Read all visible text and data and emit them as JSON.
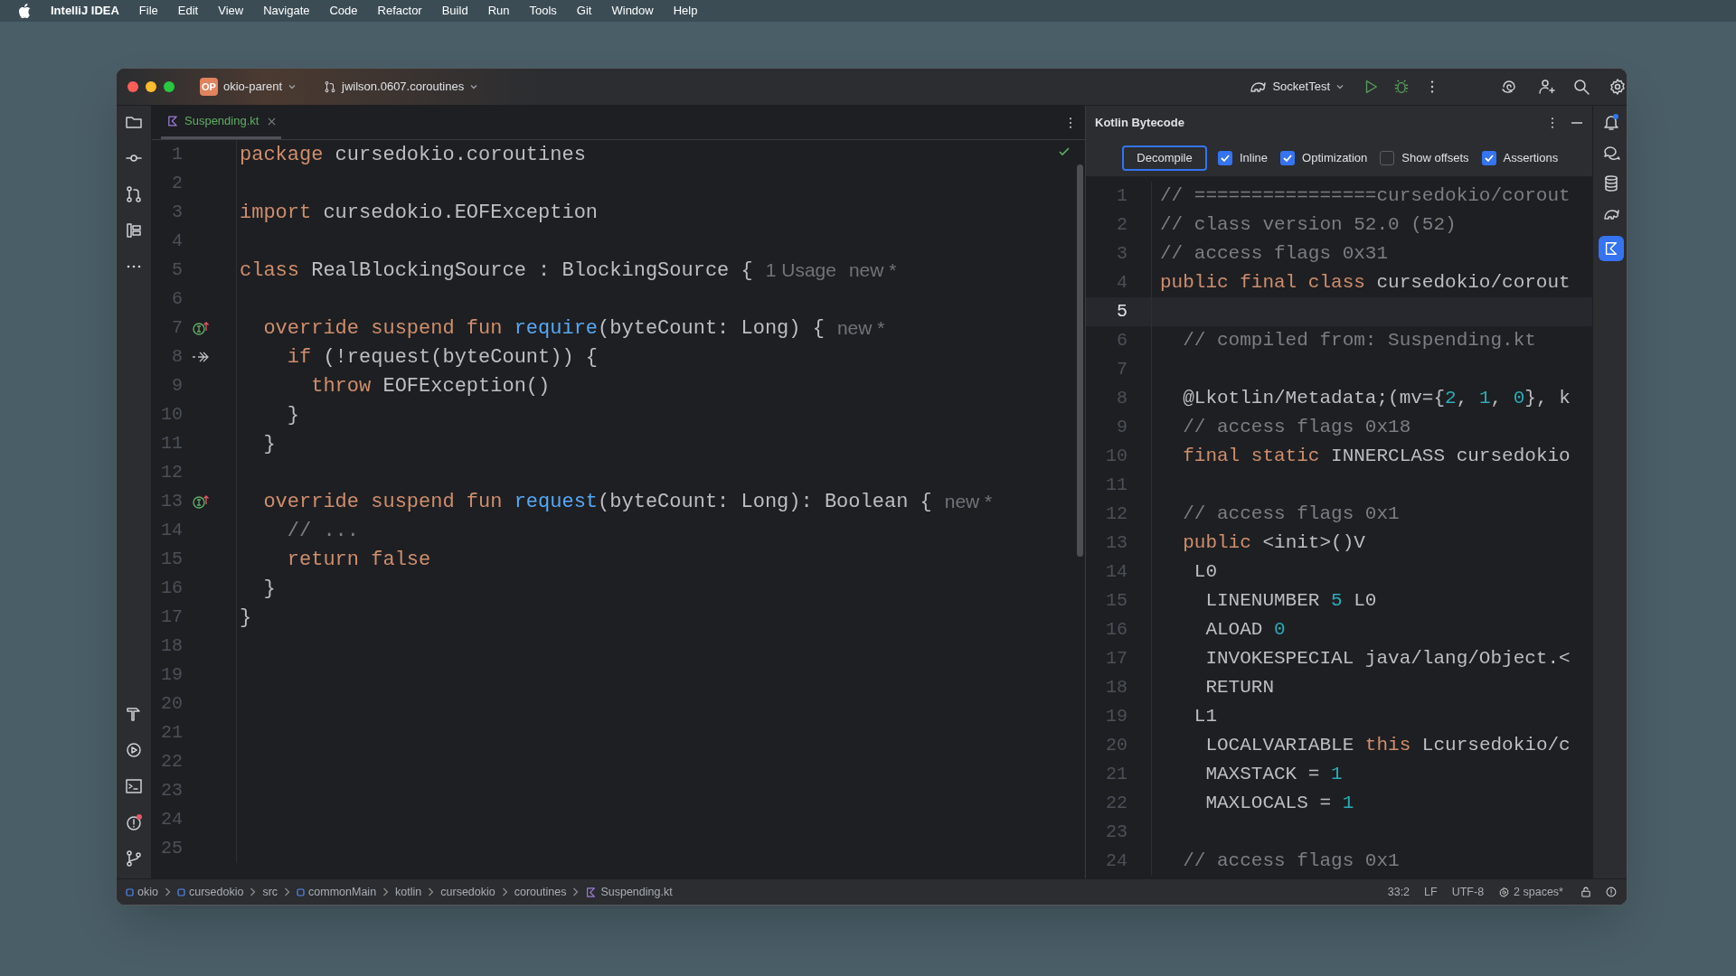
{
  "menu_bar": {
    "app_name": "IntelliJ IDEA",
    "menus": [
      "File",
      "Edit",
      "View",
      "Navigate",
      "Code",
      "Refactor",
      "Build",
      "Run",
      "Tools",
      "Git",
      "Window",
      "Help"
    ]
  },
  "title_bar": {
    "project_badge": "OP",
    "project": "okio-parent",
    "branch": "jwilson.0607.coroutines",
    "run_configuration": "SocketTest"
  },
  "editor": {
    "tabs": [
      {
        "label": "Suspending.kt",
        "selected": true
      }
    ],
    "lines": [
      {
        "number": "1",
        "tokens": [
          {
            "kind": "keyword",
            "text": "package"
          },
          {
            "kind": "plain",
            "text": " cursedokio.coroutines"
          }
        ]
      },
      {
        "number": "2"
      },
      {
        "number": "3",
        "tokens": [
          {
            "kind": "keyword",
            "text": "import"
          },
          {
            "kind": "plain",
            "text": " cursedokio.EOFException"
          }
        ]
      },
      {
        "number": "4"
      },
      {
        "number": "5",
        "tokens": [
          {
            "kind": "keyword",
            "text": "class"
          },
          {
            "kind": "plain",
            "text": " RealBlockingSource : BlockingSource {"
          }
        ],
        "hints": [
          "1 Usage",
          "new *"
        ]
      },
      {
        "number": "6"
      },
      {
        "number": "7",
        "gutter": {
          "kind": "overrides"
        },
        "tokens": [
          {
            "kind": "keyword",
            "text": "  override suspend fun "
          },
          {
            "kind": "function",
            "text": "require"
          },
          {
            "kind": "plain",
            "text": "(byteCount: Long) {"
          }
        ],
        "hints": [
          "new *"
        ]
      },
      {
        "number": "8",
        "gutter": {
          "kind": "suspend_call"
        },
        "tokens": [
          {
            "kind": "keyword",
            "text": "    if"
          },
          {
            "kind": "plain",
            "text": " (!request(byteCount)) {"
          }
        ]
      },
      {
        "number": "9",
        "tokens": [
          {
            "kind": "keyword",
            "text": "      throw"
          },
          {
            "kind": "plain",
            "text": " EOFException()"
          }
        ]
      },
      {
        "number": "10",
        "tokens": [
          {
            "kind": "plain",
            "text": "    }"
          }
        ]
      },
      {
        "number": "11",
        "tokens": [
          {
            "kind": "plain",
            "text": "  }"
          }
        ]
      },
      {
        "number": "12"
      },
      {
        "number": "13",
        "gutter": {
          "kind": "overrides"
        },
        "tokens": [
          {
            "kind": "keyword",
            "text": "  override suspend fun "
          },
          {
            "kind": "function",
            "text": "request"
          },
          {
            "kind": "plain",
            "text": "(byteCount: Long): Boolean {"
          }
        ],
        "hints": [
          "new *"
        ]
      },
      {
        "number": "14",
        "tokens": [
          {
            "kind": "comment",
            "text": "    // ..."
          }
        ]
      },
      {
        "number": "15",
        "tokens": [
          {
            "kind": "keyword",
            "text": "    return false"
          }
        ]
      },
      {
        "number": "16",
        "tokens": [
          {
            "kind": "plain",
            "text": "  }"
          }
        ]
      },
      {
        "number": "17",
        "tokens": [
          {
            "kind": "plain",
            "text": "}"
          }
        ]
      },
      {
        "number": "18"
      },
      {
        "number": "19"
      },
      {
        "number": "20"
      },
      {
        "number": "21"
      },
      {
        "number": "22"
      },
      {
        "number": "23"
      },
      {
        "number": "24"
      },
      {
        "number": "25"
      }
    ]
  },
  "bytecode_panel": {
    "title": "Kotlin Bytecode",
    "decompile_button": "Decompile",
    "options": [
      {
        "label": "Inline",
        "checked": true
      },
      {
        "label": "Optimization",
        "checked": true
      },
      {
        "label": "Show offsets",
        "checked": false
      },
      {
        "label": "Assertions",
        "checked": true
      }
    ],
    "lines": [
      {
        "number": "1",
        "current": false,
        "tokens": [
          {
            "kind": "comment",
            "text": "// ================cursedokio/corout"
          }
        ]
      },
      {
        "number": "2",
        "current": false,
        "tokens": [
          {
            "kind": "comment",
            "text": "// class version 52.0 (52)"
          }
        ]
      },
      {
        "number": "3",
        "current": false,
        "tokens": [
          {
            "kind": "comment",
            "text": "// access flags 0x31"
          }
        ]
      },
      {
        "number": "4",
        "current": false,
        "tokens": [
          {
            "kind": "keyword",
            "text": "public final class"
          },
          {
            "kind": "plain",
            "text": " cursedokio/corout"
          }
        ]
      },
      {
        "number": "5",
        "current": true
      },
      {
        "number": "6",
        "current": false,
        "tokens": [
          {
            "kind": "comment",
            "text": "  // compiled from: Suspending.kt"
          }
        ]
      },
      {
        "number": "7",
        "current": false
      },
      {
        "number": "8",
        "current": false,
        "tokens": [
          {
            "kind": "plain",
            "text": "  @Lkotlin/Metadata;(mv={"
          },
          {
            "kind": "number",
            "text": "2"
          },
          {
            "kind": "plain",
            "text": ", "
          },
          {
            "kind": "number",
            "text": "1"
          },
          {
            "kind": "plain",
            "text": ", "
          },
          {
            "kind": "number",
            "text": "0"
          },
          {
            "kind": "plain",
            "text": "}, k"
          }
        ]
      },
      {
        "number": "9",
        "current": false,
        "tokens": [
          {
            "kind": "comment",
            "text": "  // access flags 0x18"
          }
        ]
      },
      {
        "number": "10",
        "current": false,
        "tokens": [
          {
            "kind": "keyword",
            "text": "  final static"
          },
          {
            "kind": "plain",
            "text": " INNERCLASS cursedokio"
          }
        ]
      },
      {
        "number": "11",
        "current": false
      },
      {
        "number": "12",
        "current": false,
        "tokens": [
          {
            "kind": "comment",
            "text": "  // access flags 0x1"
          }
        ]
      },
      {
        "number": "13",
        "current": false,
        "tokens": [
          {
            "kind": "keyword",
            "text": "  public"
          },
          {
            "kind": "plain",
            "text": " <init>()V"
          }
        ]
      },
      {
        "number": "14",
        "current": false,
        "tokens": [
          {
            "kind": "plain",
            "text": "   L0"
          }
        ]
      },
      {
        "number": "15",
        "current": false,
        "tokens": [
          {
            "kind": "plain",
            "text": "    LINENUMBER "
          },
          {
            "kind": "number",
            "text": "5"
          },
          {
            "kind": "plain",
            "text": " L0"
          }
        ]
      },
      {
        "number": "16",
        "current": false,
        "tokens": [
          {
            "kind": "plain",
            "text": "    ALOAD "
          },
          {
            "kind": "number",
            "text": "0"
          }
        ]
      },
      {
        "number": "17",
        "current": false,
        "tokens": [
          {
            "kind": "plain",
            "text": "    INVOKESPECIAL java/lang/Object.<"
          }
        ]
      },
      {
        "number": "18",
        "current": false,
        "tokens": [
          {
            "kind": "plain",
            "text": "    RETURN"
          }
        ]
      },
      {
        "number": "19",
        "current": false,
        "tokens": [
          {
            "kind": "plain",
            "text": "   L1"
          }
        ]
      },
      {
        "number": "20",
        "current": false,
        "tokens": [
          {
            "kind": "plain",
            "text": "    LOCALVARIABLE "
          },
          {
            "kind": "keyword",
            "text": "this"
          },
          {
            "kind": "plain",
            "text": " Lcursedokio/c"
          }
        ]
      },
      {
        "number": "21",
        "current": false,
        "tokens": [
          {
            "kind": "plain",
            "text": "    MAXSTACK = "
          },
          {
            "kind": "number",
            "text": "1"
          }
        ]
      },
      {
        "number": "22",
        "current": false,
        "tokens": [
          {
            "kind": "plain",
            "text": "    MAXLOCALS = "
          },
          {
            "kind": "number",
            "text": "1"
          }
        ]
      },
      {
        "number": "23",
        "current": false
      },
      {
        "number": "24",
        "current": false,
        "tokens": [
          {
            "kind": "comment",
            "text": "  // access flags 0x1"
          }
        ]
      }
    ]
  },
  "status_bar": {
    "breadcrumbs": [
      {
        "kind": "module",
        "label": "okio"
      },
      {
        "kind": "module",
        "label": "cursedokio"
      },
      {
        "kind": "folder",
        "label": "src"
      },
      {
        "kind": "module",
        "label": "commonMain"
      },
      {
        "kind": "folder",
        "label": "kotlin"
      },
      {
        "kind": "folder",
        "label": "cursedokio"
      },
      {
        "kind": "folder",
        "label": "coroutines"
      },
      {
        "kind": "file",
        "label": "Suspending.kt"
      }
    ],
    "position": "33:2",
    "line_separator": "LF",
    "encoding": "UTF-8",
    "indent": "2 spaces*"
  }
}
